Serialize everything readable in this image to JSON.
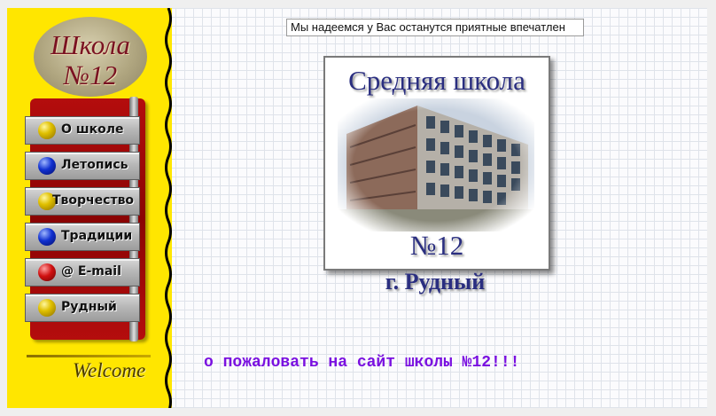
{
  "sidebar": {
    "logo_line1": "Школа",
    "logo_line2": "№12",
    "menu": [
      {
        "label": "О школе",
        "bullet": "yellow"
      },
      {
        "label": "Летопись",
        "bullet": "blue"
      },
      {
        "label": "Творчество",
        "bullet": "yellow"
      },
      {
        "label": "Традиции",
        "bullet": "blue"
      },
      {
        "label": "@ E-mail",
        "bullet": "red"
      },
      {
        "label": "Рудный",
        "bullet": "yellow"
      }
    ],
    "welcome": "Welcome"
  },
  "main": {
    "marquee_text": "Мы надеемся у Вас останутся приятные впечатлен",
    "card_title": "Средняя школа",
    "card_number": "№12",
    "city": "г. Рудный",
    "welcome_text": "о пожаловать на сайт школы №12!!!"
  },
  "colors": {
    "sidebar_bg": "#ffe600",
    "menu_panel": "#8a0303",
    "title_text": "#2a2e80",
    "welcome_text": "#7a10e0"
  }
}
